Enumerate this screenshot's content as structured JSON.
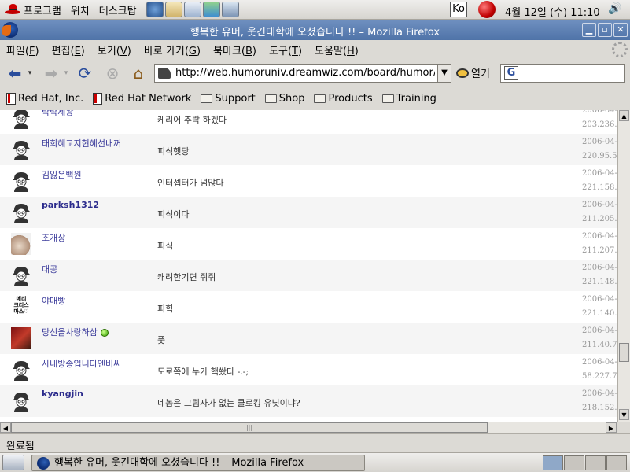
{
  "top_panel": {
    "menus": [
      "프로그램",
      "위치",
      "데스크탑"
    ],
    "ime_label": "Ko",
    "clock": "4월 12일 (수) 11:10"
  },
  "window": {
    "title": "행복한 유머, 웃긴대학에 오셨습니다 !! – Mozilla Firefox"
  },
  "menubar": {
    "items": [
      {
        "label": "파일(",
        "key": "F",
        "end": ")"
      },
      {
        "label": "편집(",
        "key": "E",
        "end": ")"
      },
      {
        "label": "보기(",
        "key": "V",
        "end": ")"
      },
      {
        "label": "바로 가기(",
        "key": "G",
        "end": ")"
      },
      {
        "label": "북마크(",
        "key": "B",
        "end": ")"
      },
      {
        "label": "도구(",
        "key": "T",
        "end": ")"
      },
      {
        "label": "도움말(",
        "key": "H",
        "end": ")"
      }
    ]
  },
  "navbar": {
    "url": "http://web.humoruniv.dreamwiz.com/board/humor/read.html",
    "go_label": "열기"
  },
  "bookmarks": [
    {
      "label": "Red Hat, Inc.",
      "icon": "doc"
    },
    {
      "label": "Red Hat Network",
      "icon": "doc"
    },
    {
      "label": "Support",
      "icon": "folder"
    },
    {
      "label": "Shop",
      "icon": "folder"
    },
    {
      "label": "Products",
      "icon": "folder"
    },
    {
      "label": "Training",
      "icon": "folder"
    }
  ],
  "comments": [
    {
      "nick": "탁탁제왕",
      "bold": false,
      "avatar": "default",
      "msg": "케리어 추락 하겠다",
      "date": "2006-04-",
      "ip": "203.236.1"
    },
    {
      "nick": "태희혜교지현혜선내꺼",
      "bold": false,
      "avatar": "default",
      "msg": "피식햇당",
      "date": "2006-04-",
      "ip": "220.95.56"
    },
    {
      "nick": "김잃은백원",
      "bold": false,
      "avatar": "default",
      "msg": "인터셉터가 넘많다",
      "date": "2006-04-",
      "ip": "221.158.7"
    },
    {
      "nick": "parksh1312",
      "bold": true,
      "avatar": "default",
      "msg": "피식이다",
      "date": "2006-04-",
      "ip": "211.205.1"
    },
    {
      "nick": "조개상",
      "bold": false,
      "avatar": "shell",
      "msg": "피식",
      "date": "2006-04-",
      "ip": "211.207.1"
    },
    {
      "nick": "대공",
      "bold": false,
      "avatar": "default",
      "msg": "캐려한기면 쥐쥐",
      "date": "2006-04-",
      "ip": "221.148.1"
    },
    {
      "nick": "야매빵",
      "bold": false,
      "avatar": "text",
      "avatar_text": "메리\n크리스\n마스♡",
      "msg": "피힉",
      "date": "2006-04-",
      "ip": "221.140.2"
    },
    {
      "nick": "당신을사랑하삼",
      "bold": false,
      "avatar": "photo",
      "online": true,
      "msg": "풋",
      "date": "2006-04-",
      "ip": "211.40.75"
    },
    {
      "nick": "사내방송입니다엔비씨",
      "bold": false,
      "avatar": "default",
      "msg": "도로쪽에 누가 핵쐈다 -.-;",
      "date": "2006-04-",
      "ip": "58.227.77"
    },
    {
      "nick": "kyangjin",
      "bold": true,
      "avatar": "default",
      "msg": "네놈은 그림자가 없는 클로킹 유닛이냐?",
      "date": "2006-04-",
      "ip": "218.152."
    }
  ],
  "statusbar": {
    "text": "완료됨"
  },
  "taskbar": {
    "task_label": "행복한 유머, 웃긴대학에 오셨습니다 !! – Mozilla Firefox"
  }
}
